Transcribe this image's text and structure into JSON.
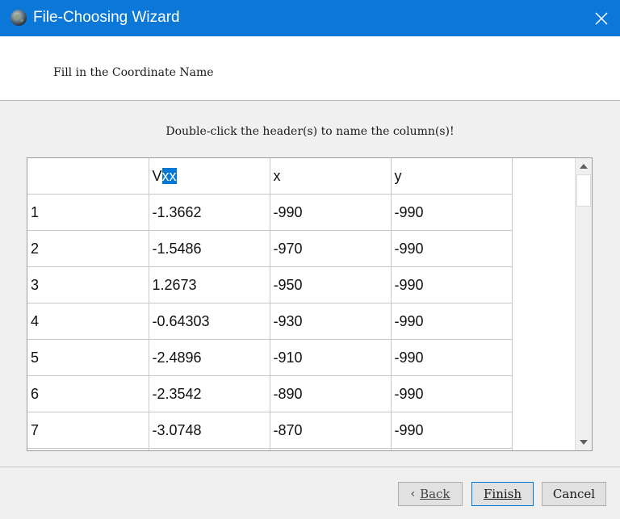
{
  "window": {
    "title": "File-Choosing Wizard"
  },
  "header": {
    "text": "Fill in the Coordinate Name"
  },
  "instruction": "Double-click the header(s) to name the column(s)!",
  "table": {
    "header_cells": [
      "",
      "V",
      "xx",
      "x",
      "y"
    ],
    "column_headers": {
      "corner": "",
      "col1_prefix": "V",
      "col1_selected": "xx",
      "col2": "x",
      "col3": "y"
    },
    "rows": [
      [
        "1",
        "-1.3662",
        "-990",
        "-990"
      ],
      [
        "2",
        "-1.5486",
        "-970",
        "-990"
      ],
      [
        "3",
        "1.2673",
        "-950",
        "-990"
      ],
      [
        "4",
        "-0.64303",
        "-930",
        "-990"
      ],
      [
        "5",
        "-2.4896",
        "-910",
        "-990"
      ],
      [
        "6",
        "-2.3542",
        "-890",
        "-990"
      ],
      [
        "7",
        "-3.0748",
        "-870",
        "-990"
      ]
    ]
  },
  "buttons": {
    "back": "Back",
    "finish": "Finish",
    "cancel": "Cancel"
  },
  "icons": {
    "app": "globe-icon",
    "close": "close-icon",
    "scroll_up": "scroll-up-arrow-icon",
    "scroll_down": "scroll-down-arrow-icon",
    "back_chevron": "chevron-left-icon"
  },
  "colors": {
    "titlebar": "#0b78d7",
    "selection": "#0078d7"
  }
}
